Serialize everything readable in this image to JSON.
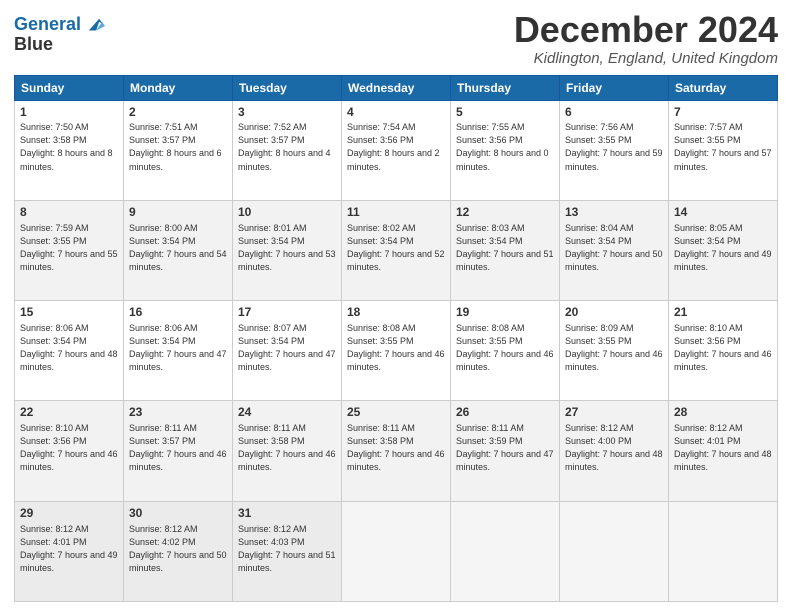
{
  "logo": {
    "line1": "General",
    "line2": "Blue"
  },
  "title": "December 2024",
  "location": "Kidlington, England, United Kingdom",
  "days_header": [
    "Sunday",
    "Monday",
    "Tuesday",
    "Wednesday",
    "Thursday",
    "Friday",
    "Saturday"
  ],
  "weeks": [
    [
      {
        "day": "1",
        "sunrise": "Sunrise: 7:50 AM",
        "sunset": "Sunset: 3:58 PM",
        "daylight": "Daylight: 8 hours and 8 minutes."
      },
      {
        "day": "2",
        "sunrise": "Sunrise: 7:51 AM",
        "sunset": "Sunset: 3:57 PM",
        "daylight": "Daylight: 8 hours and 6 minutes."
      },
      {
        "day": "3",
        "sunrise": "Sunrise: 7:52 AM",
        "sunset": "Sunset: 3:57 PM",
        "daylight": "Daylight: 8 hours and 4 minutes."
      },
      {
        "day": "4",
        "sunrise": "Sunrise: 7:54 AM",
        "sunset": "Sunset: 3:56 PM",
        "daylight": "Daylight: 8 hours and 2 minutes."
      },
      {
        "day": "5",
        "sunrise": "Sunrise: 7:55 AM",
        "sunset": "Sunset: 3:56 PM",
        "daylight": "Daylight: 8 hours and 0 minutes."
      },
      {
        "day": "6",
        "sunrise": "Sunrise: 7:56 AM",
        "sunset": "Sunset: 3:55 PM",
        "daylight": "Daylight: 7 hours and 59 minutes."
      },
      {
        "day": "7",
        "sunrise": "Sunrise: 7:57 AM",
        "sunset": "Sunset: 3:55 PM",
        "daylight": "Daylight: 7 hours and 57 minutes."
      }
    ],
    [
      {
        "day": "8",
        "sunrise": "Sunrise: 7:59 AM",
        "sunset": "Sunset: 3:55 PM",
        "daylight": "Daylight: 7 hours and 55 minutes."
      },
      {
        "day": "9",
        "sunrise": "Sunrise: 8:00 AM",
        "sunset": "Sunset: 3:54 PM",
        "daylight": "Daylight: 7 hours and 54 minutes."
      },
      {
        "day": "10",
        "sunrise": "Sunrise: 8:01 AM",
        "sunset": "Sunset: 3:54 PM",
        "daylight": "Daylight: 7 hours and 53 minutes."
      },
      {
        "day": "11",
        "sunrise": "Sunrise: 8:02 AM",
        "sunset": "Sunset: 3:54 PM",
        "daylight": "Daylight: 7 hours and 52 minutes."
      },
      {
        "day": "12",
        "sunrise": "Sunrise: 8:03 AM",
        "sunset": "Sunset: 3:54 PM",
        "daylight": "Daylight: 7 hours and 51 minutes."
      },
      {
        "day": "13",
        "sunrise": "Sunrise: 8:04 AM",
        "sunset": "Sunset: 3:54 PM",
        "daylight": "Daylight: 7 hours and 50 minutes."
      },
      {
        "day": "14",
        "sunrise": "Sunrise: 8:05 AM",
        "sunset": "Sunset: 3:54 PM",
        "daylight": "Daylight: 7 hours and 49 minutes."
      }
    ],
    [
      {
        "day": "15",
        "sunrise": "Sunrise: 8:06 AM",
        "sunset": "Sunset: 3:54 PM",
        "daylight": "Daylight: 7 hours and 48 minutes."
      },
      {
        "day": "16",
        "sunrise": "Sunrise: 8:06 AM",
        "sunset": "Sunset: 3:54 PM",
        "daylight": "Daylight: 7 hours and 47 minutes."
      },
      {
        "day": "17",
        "sunrise": "Sunrise: 8:07 AM",
        "sunset": "Sunset: 3:54 PM",
        "daylight": "Daylight: 7 hours and 47 minutes."
      },
      {
        "day": "18",
        "sunrise": "Sunrise: 8:08 AM",
        "sunset": "Sunset: 3:55 PM",
        "daylight": "Daylight: 7 hours and 46 minutes."
      },
      {
        "day": "19",
        "sunrise": "Sunrise: 8:08 AM",
        "sunset": "Sunset: 3:55 PM",
        "daylight": "Daylight: 7 hours and 46 minutes."
      },
      {
        "day": "20",
        "sunrise": "Sunrise: 8:09 AM",
        "sunset": "Sunset: 3:55 PM",
        "daylight": "Daylight: 7 hours and 46 minutes."
      },
      {
        "day": "21",
        "sunrise": "Sunrise: 8:10 AM",
        "sunset": "Sunset: 3:56 PM",
        "daylight": "Daylight: 7 hours and 46 minutes."
      }
    ],
    [
      {
        "day": "22",
        "sunrise": "Sunrise: 8:10 AM",
        "sunset": "Sunset: 3:56 PM",
        "daylight": "Daylight: 7 hours and 46 minutes."
      },
      {
        "day": "23",
        "sunrise": "Sunrise: 8:11 AM",
        "sunset": "Sunset: 3:57 PM",
        "daylight": "Daylight: 7 hours and 46 minutes."
      },
      {
        "day": "24",
        "sunrise": "Sunrise: 8:11 AM",
        "sunset": "Sunset: 3:58 PM",
        "daylight": "Daylight: 7 hours and 46 minutes."
      },
      {
        "day": "25",
        "sunrise": "Sunrise: 8:11 AM",
        "sunset": "Sunset: 3:58 PM",
        "daylight": "Daylight: 7 hours and 46 minutes."
      },
      {
        "day": "26",
        "sunrise": "Sunrise: 8:11 AM",
        "sunset": "Sunset: 3:59 PM",
        "daylight": "Daylight: 7 hours and 47 minutes."
      },
      {
        "day": "27",
        "sunrise": "Sunrise: 8:12 AM",
        "sunset": "Sunset: 4:00 PM",
        "daylight": "Daylight: 7 hours and 48 minutes."
      },
      {
        "day": "28",
        "sunrise": "Sunrise: 8:12 AM",
        "sunset": "Sunset: 4:01 PM",
        "daylight": "Daylight: 7 hours and 48 minutes."
      }
    ],
    [
      {
        "day": "29",
        "sunrise": "Sunrise: 8:12 AM",
        "sunset": "Sunset: 4:01 PM",
        "daylight": "Daylight: 7 hours and 49 minutes."
      },
      {
        "day": "30",
        "sunrise": "Sunrise: 8:12 AM",
        "sunset": "Sunset: 4:02 PM",
        "daylight": "Daylight: 7 hours and 50 minutes."
      },
      {
        "day": "31",
        "sunrise": "Sunrise: 8:12 AM",
        "sunset": "Sunset: 4:03 PM",
        "daylight": "Daylight: 7 hours and 51 minutes."
      },
      null,
      null,
      null,
      null
    ]
  ]
}
